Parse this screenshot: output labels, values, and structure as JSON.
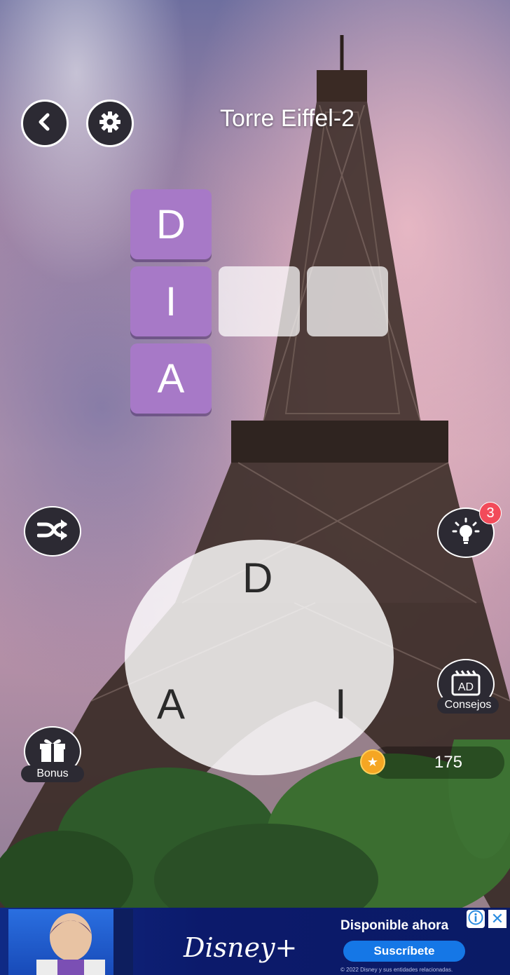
{
  "header": {
    "title": "Torre Eiffel-2",
    "back_icon": "chevron-left-icon",
    "settings_icon": "gear-icon"
  },
  "board": {
    "column": [
      "D",
      "I",
      "A"
    ],
    "row_empty_count": 2,
    "filled_color": "#a779c7"
  },
  "wheel": {
    "letters": {
      "top": "D",
      "left": "A",
      "right": "I"
    }
  },
  "controls": {
    "shuffle_icon": "shuffle-icon",
    "hint_icon": "lightbulb-icon",
    "hint_badge": "3",
    "ad_hint_icon": "ad-video-icon",
    "ad_hint_icon_text": "AD",
    "ad_hint_label": "Consejos",
    "bonus_icon": "gift-icon",
    "bonus_label": "Bonus",
    "coins": "175",
    "coin_icon": "star-coin-icon"
  },
  "ad": {
    "logo": "Disney+",
    "headline": "Disponible ahora",
    "cta": "Suscríbete",
    "legal": "© 2022 Disney y sus entidades relacionadas.",
    "info_icon": "info-icon",
    "close_icon": "close-icon",
    "close_glyph": "✕"
  }
}
